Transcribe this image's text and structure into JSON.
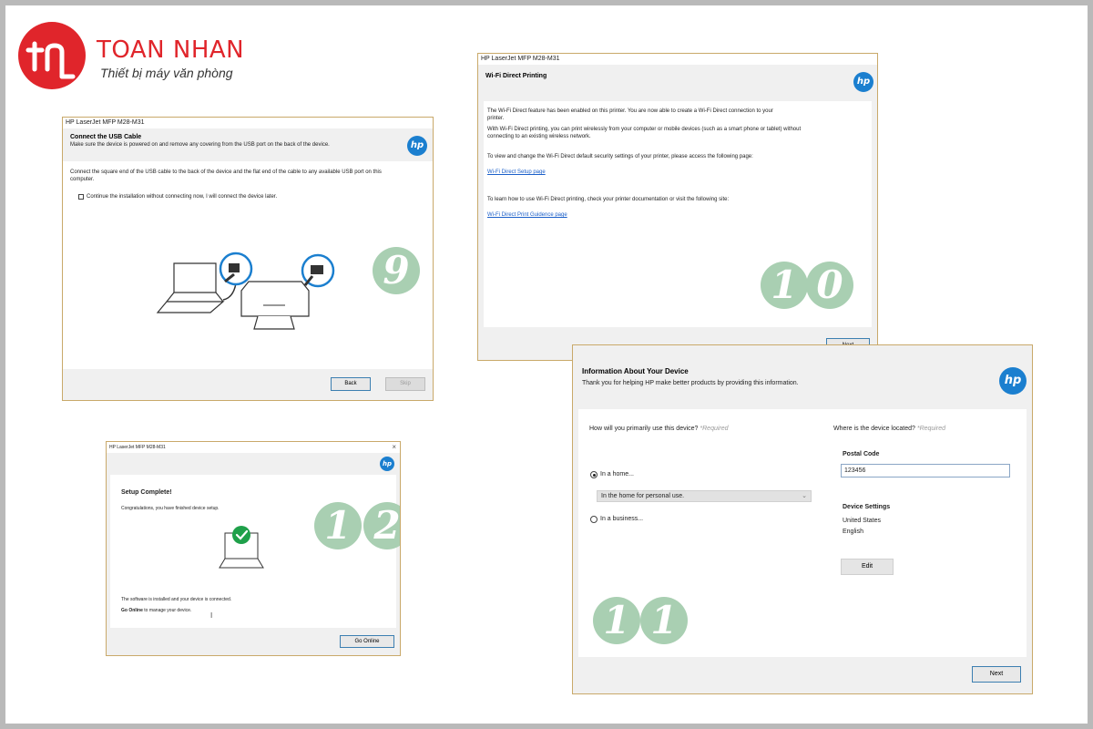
{
  "logo": {
    "mark": "tn",
    "brand": "TOAN NHAN",
    "tagline": "Thiết bị máy văn phòng"
  },
  "hp_mark": "hp",
  "win9": {
    "title": "HP LaserJet MFP M28-M31",
    "heading": "Connect the USB Cable",
    "subheading": "Make sure the device is powered on and remove any covering from the USB port on the back of the device.",
    "body_line1": "Connect the square end of the USB cable to the back of the device and the flat end of the cable to any available USB port on this",
    "body_line2": "computer.",
    "checkbox_label": "Continue the installation without connecting now, I will connect the device later.",
    "back_label": "Back",
    "skip_label": "Skip",
    "step": "9"
  },
  "win10": {
    "title": "HP LaserJet MFP M28-M31",
    "heading": "Wi-Fi Direct Printing",
    "p1_line1": "The Wi-Fi Direct feature has been enabled on this printer. You are now able to create a Wi-Fi Direct connection to your",
    "p1_line2": "printer.",
    "p2_line1": "With Wi-Fi Direct printing, you can print wirelessly from your computer or mobile devices (such as a smart phone or tablet) without",
    "p2_line2": "connecting to an existing wireless network.",
    "p3": "To view and change the Wi-Fi Direct default security settings of your printer, please access the following page:",
    "link1": "Wi-Fi Direct Setup page",
    "p4": "To learn how to use Wi-Fi Direct printing, check your printer documentation or visit the following site:",
    "link2": "Wi-Fi Direct Print Guidence page",
    "next_label": "Next",
    "step_a": "1",
    "step_b": "0"
  },
  "win11": {
    "heading": "Information About Your Device",
    "subheading": "Thank you for helping HP make better products by providing this information.",
    "q_use": "How will you primarily use this device?",
    "q_use_req": "*Required",
    "q_loc": "Where is the device located?",
    "q_loc_req": "*Required",
    "radio_home": "In a home...",
    "radio_business": "In a business...",
    "home_select_value": "In the home for personal use.",
    "postal_label": "Postal Code",
    "postal_value": "123456",
    "settings_label": "Device Settings",
    "country": "United States",
    "language": "English",
    "edit_label": "Edit",
    "next_label": "Next",
    "step_a": "1",
    "step_b": "1"
  },
  "win12": {
    "title": "HP LaserJet MFP M28-M31",
    "close": "×",
    "heading": "Setup Complete!",
    "congrats": "Congratulations, you have finished device setup.",
    "installed": "The software is installed and your device is connected.",
    "go_online_bold": "Go Online",
    "go_online_rest": "to manage your device.",
    "button_label": "Go Online",
    "step_a": "1",
    "step_b": "2"
  },
  "colors": {
    "brand_red": "#e0252b",
    "hp_blue": "#1b7fcf",
    "badge_green": "#a9cfb2",
    "link_blue": "#1b5fc9",
    "check_green": "#1fa04a"
  }
}
